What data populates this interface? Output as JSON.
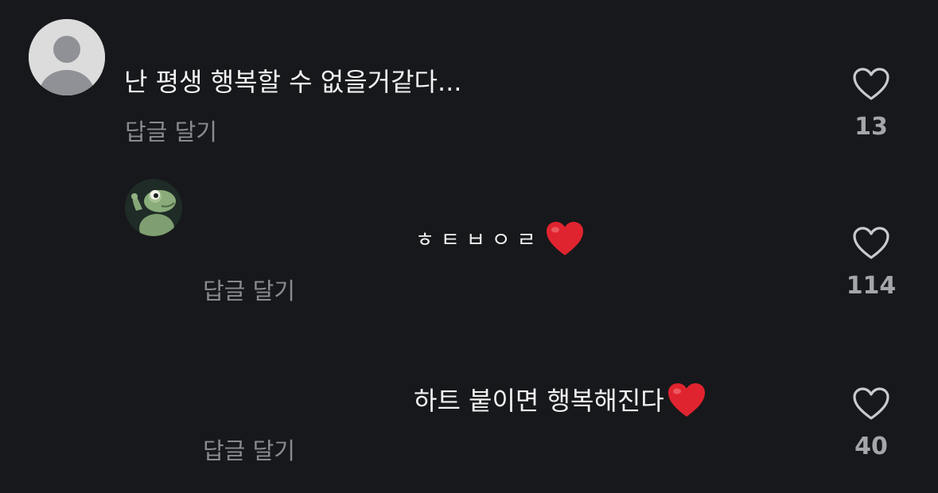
{
  "comments": [
    {
      "avatar": "default-user-avatar",
      "text": "난 평생 행복할 수 없을거같다...",
      "reply_label": "답글 달기",
      "like_icon": "heart-outline-icon",
      "like_count": "13"
    },
    {
      "avatar": "frog-avatar",
      "text": "ㅎㅌㅂㅇㄹ",
      "emoji": "red-heart-emoji",
      "reply_label": "답글 달기",
      "like_icon": "heart-outline-icon",
      "like_count": "114"
    },
    {
      "text": "하트 붙이면 행복해진다",
      "emoji": "red-heart-emoji",
      "reply_label": "답글 달기",
      "like_icon": "heart-outline-icon",
      "like_count": "40"
    }
  ],
  "colors": {
    "background": "#17181b",
    "text": "#f2f2f2",
    "secondary_text": "#8a8b90",
    "like_count": "#a5a6ab",
    "heart_emoji": "#e0242f"
  }
}
